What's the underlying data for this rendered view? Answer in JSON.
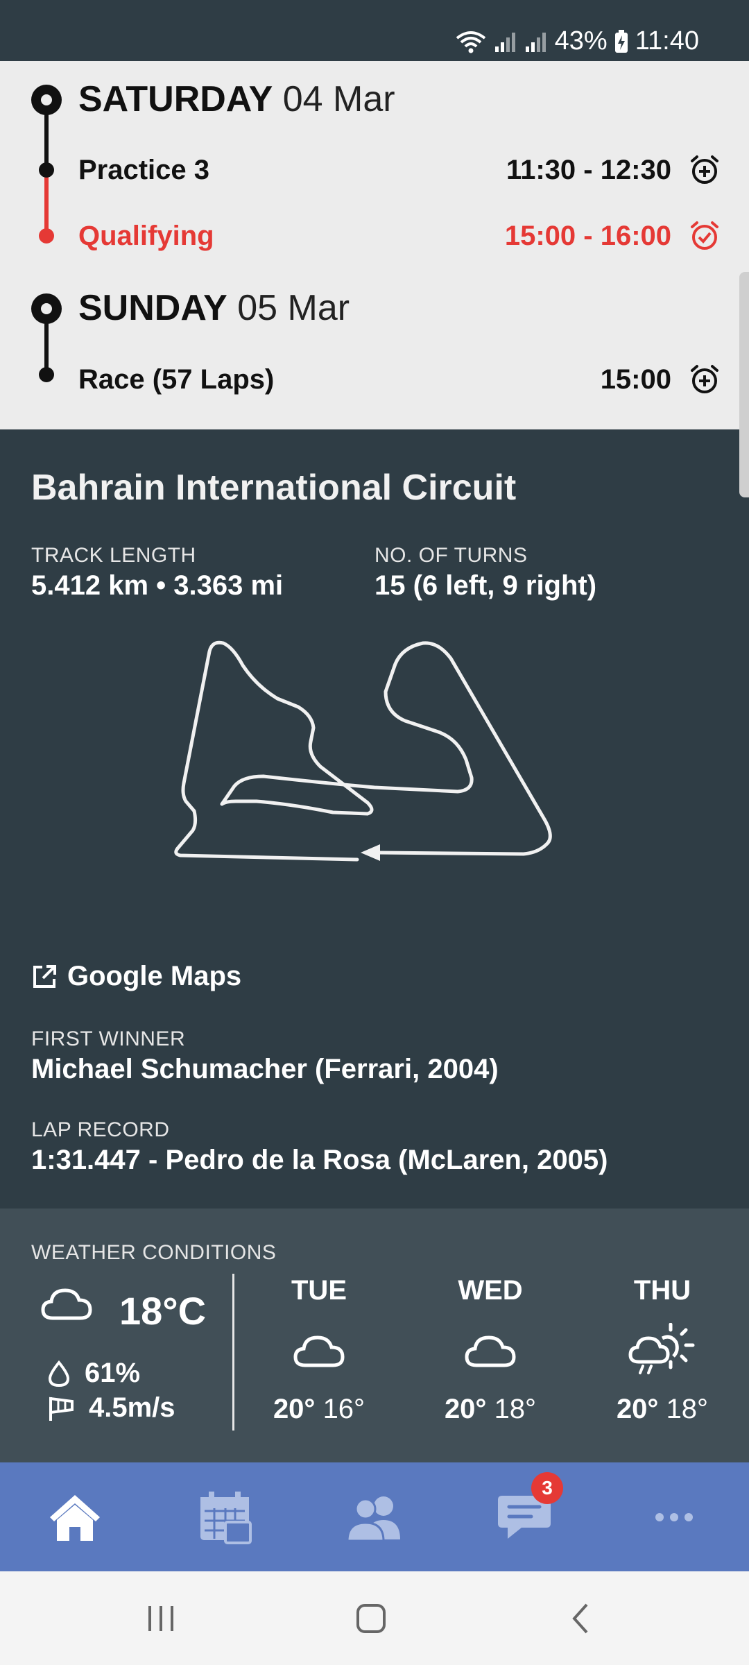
{
  "status_bar": {
    "battery": "43%",
    "time": "11:40"
  },
  "schedule": {
    "days": [
      {
        "day": "SATURDAY",
        "date": "04 Mar",
        "sessions": [
          {
            "name": "Practice 3",
            "time": "11:30 - 12:30",
            "icon": "alarm-add-icon",
            "live": false
          },
          {
            "name": "Qualifying",
            "time": "15:00 - 16:00",
            "icon": "alarm-check-icon",
            "live": true
          }
        ]
      },
      {
        "day": "SUNDAY",
        "date": "05 Mar",
        "sessions": [
          {
            "name": "Race (57 Laps)",
            "time": "15:00",
            "icon": "alarm-add-icon",
            "live": false
          }
        ]
      }
    ],
    "live_color": "#e53935"
  },
  "circuit": {
    "name": "Bahrain International Circuit",
    "track_length_label": "TRACK LENGTH",
    "track_length_value": "5.412 km • 3.363 mi",
    "turns_label": "NO. OF TURNS",
    "turns_value": "15 (6 left, 9 right)",
    "maps_link": "Google Maps",
    "first_winner_label": "FIRST WINNER",
    "first_winner_value": "Michael Schumacher (Ferrari, 2004)",
    "lap_record_label": "LAP RECORD",
    "lap_record_value": "1:31.447 - Pedro de la Rosa (McLaren, 2005)"
  },
  "weather": {
    "label": "WEATHER CONDITIONS",
    "current": {
      "temp": "18°C",
      "humidity": "61%",
      "wind": "4.5m/s",
      "icon": "cloud-icon"
    },
    "forecast": [
      {
        "day": "TUE",
        "high": "20°",
        "low": "16°",
        "icon": "cloud-icon"
      },
      {
        "day": "WED",
        "high": "20°",
        "low": "18°",
        "icon": "cloud-icon"
      },
      {
        "day": "THU",
        "high": "20°",
        "low": "18°",
        "icon": "partly-sunny-rain-icon"
      }
    ]
  },
  "bottom_nav": {
    "items": [
      "home-icon",
      "calendar-icon",
      "people-icon",
      "chat-icon",
      "more-icon"
    ],
    "chat_badge": "3"
  },
  "colors": {
    "header_dark": "#2f3d45",
    "weather_bg": "#414f57",
    "nav_blue": "#5a79bf",
    "accent_red": "#e53935"
  }
}
